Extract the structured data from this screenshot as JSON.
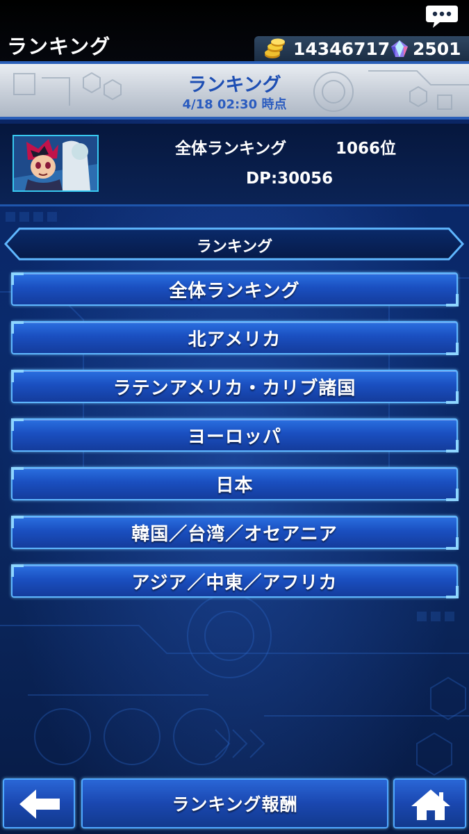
{
  "topbar": {
    "title": "ランキング",
    "coins": "14346717",
    "gems": "2501",
    "chat_icon": "chat-bubble-icon",
    "coin_icon": "gold-coins-icon",
    "gem_icon": "crystal-gem-icon"
  },
  "banner": {
    "title": "ランキング",
    "subtitle": "4/18 02:30 時点"
  },
  "profile": {
    "rank_label": "全体ランキング",
    "rank_value": "1066位",
    "dp": "DP:30056"
  },
  "ranking_panel": {
    "header": "ランキング",
    "buttons": [
      {
        "label": "全体ランキング"
      },
      {
        "label": "北アメリカ"
      },
      {
        "label": "ラテンアメリカ・カリブ諸国"
      },
      {
        "label": "ヨーロッパ"
      },
      {
        "label": "日本"
      },
      {
        "label": "韓国／台湾／オセアニア"
      },
      {
        "label": "アジア／中東／アフリカ"
      }
    ]
  },
  "bottom_nav": {
    "back_icon": "back-arrow-icon",
    "reward_label": "ランキング報酬",
    "home_icon": "home-icon"
  },
  "colors": {
    "accent": "#1d4eb3",
    "button_fill": "#1a4fc0",
    "button_border": "#5fb7ff",
    "background": "#0a2458"
  }
}
